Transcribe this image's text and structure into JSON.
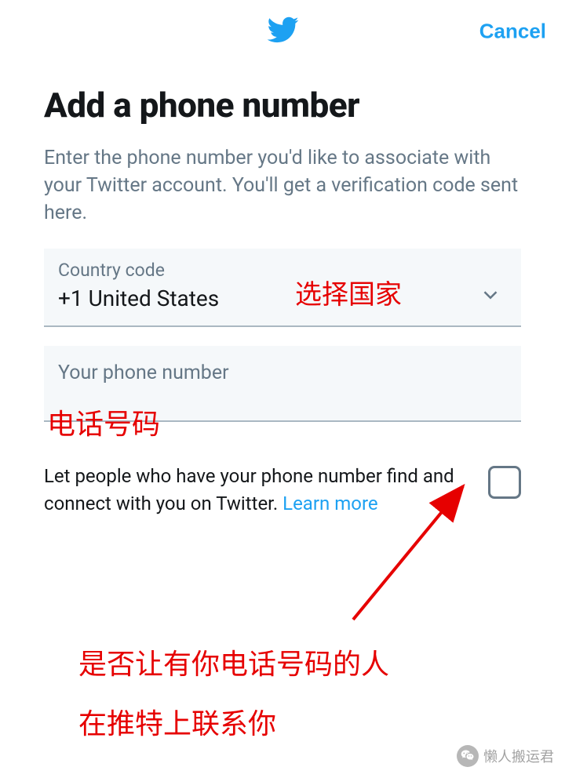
{
  "header": {
    "cancel_label": "Cancel"
  },
  "title": "Add a phone number",
  "description": "Enter the phone number you'd like to associate with your Twitter account. You'll get a verification code sent here.",
  "country_field": {
    "label": "Country code",
    "value": "+1 United States"
  },
  "phone_field": {
    "placeholder": "Your phone number"
  },
  "consent": {
    "text": "Let people who have your phone number find and connect with you on Twitter. ",
    "learn_more": "Learn more"
  },
  "annotations": {
    "country": "选择国家",
    "phone": "电话号码",
    "bottom_line1": "是否让有你电话号码的人",
    "bottom_line2": "在推特上联系你"
  },
  "watermark": {
    "text": "懒人搬运君"
  },
  "colors": {
    "brand": "#1DA1F2",
    "annotation": "#e60000"
  }
}
